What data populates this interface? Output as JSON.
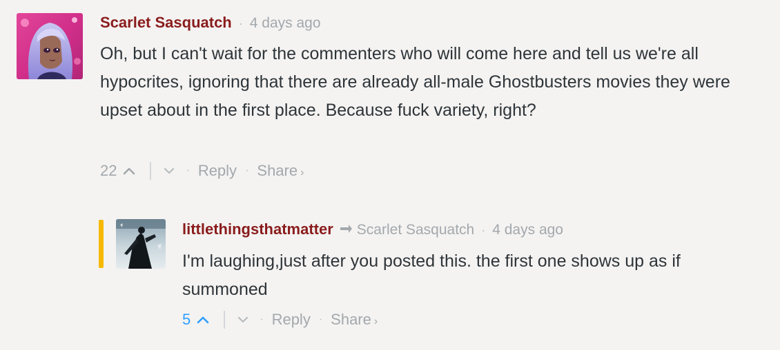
{
  "colors": {
    "author": "#8a1c1c",
    "muted": "#a3a8ac",
    "body_text": "#2e3438",
    "accent_bar": "#f6b900",
    "upvoted": "#2e9fff",
    "background": "#f4f3f2"
  },
  "comments": [
    {
      "author": "Scarlet Sasquatch",
      "time": "4 days ago",
      "body": "Oh, but I can't wait for the commenters who will come here and tell us we're all hypocrites, ignoring that there are already all-male Ghostbusters movies they were upset about in the first place. Because fuck variety, right?",
      "votes": "22",
      "reply_label": "Reply",
      "share_label": "Share",
      "share_icon": "chevron-right-icon",
      "upvote_icon": "chevron-up-icon",
      "downvote_icon": "chevron-down-icon"
    },
    {
      "author": "littlethingsthatmatter",
      "reply_to_icon": "reply-arrow-icon",
      "reply_to": "Scarlet Sasquatch",
      "time": "4 days ago",
      "body": "I'm laughing,just after you posted this. the first one shows up as if summoned",
      "votes": "5",
      "upvoted": true,
      "reply_label": "Reply",
      "share_label": "Share",
      "share_icon": "chevron-right-icon",
      "upvote_icon": "chevron-up-icon",
      "downvote_icon": "chevron-down-icon"
    }
  ]
}
